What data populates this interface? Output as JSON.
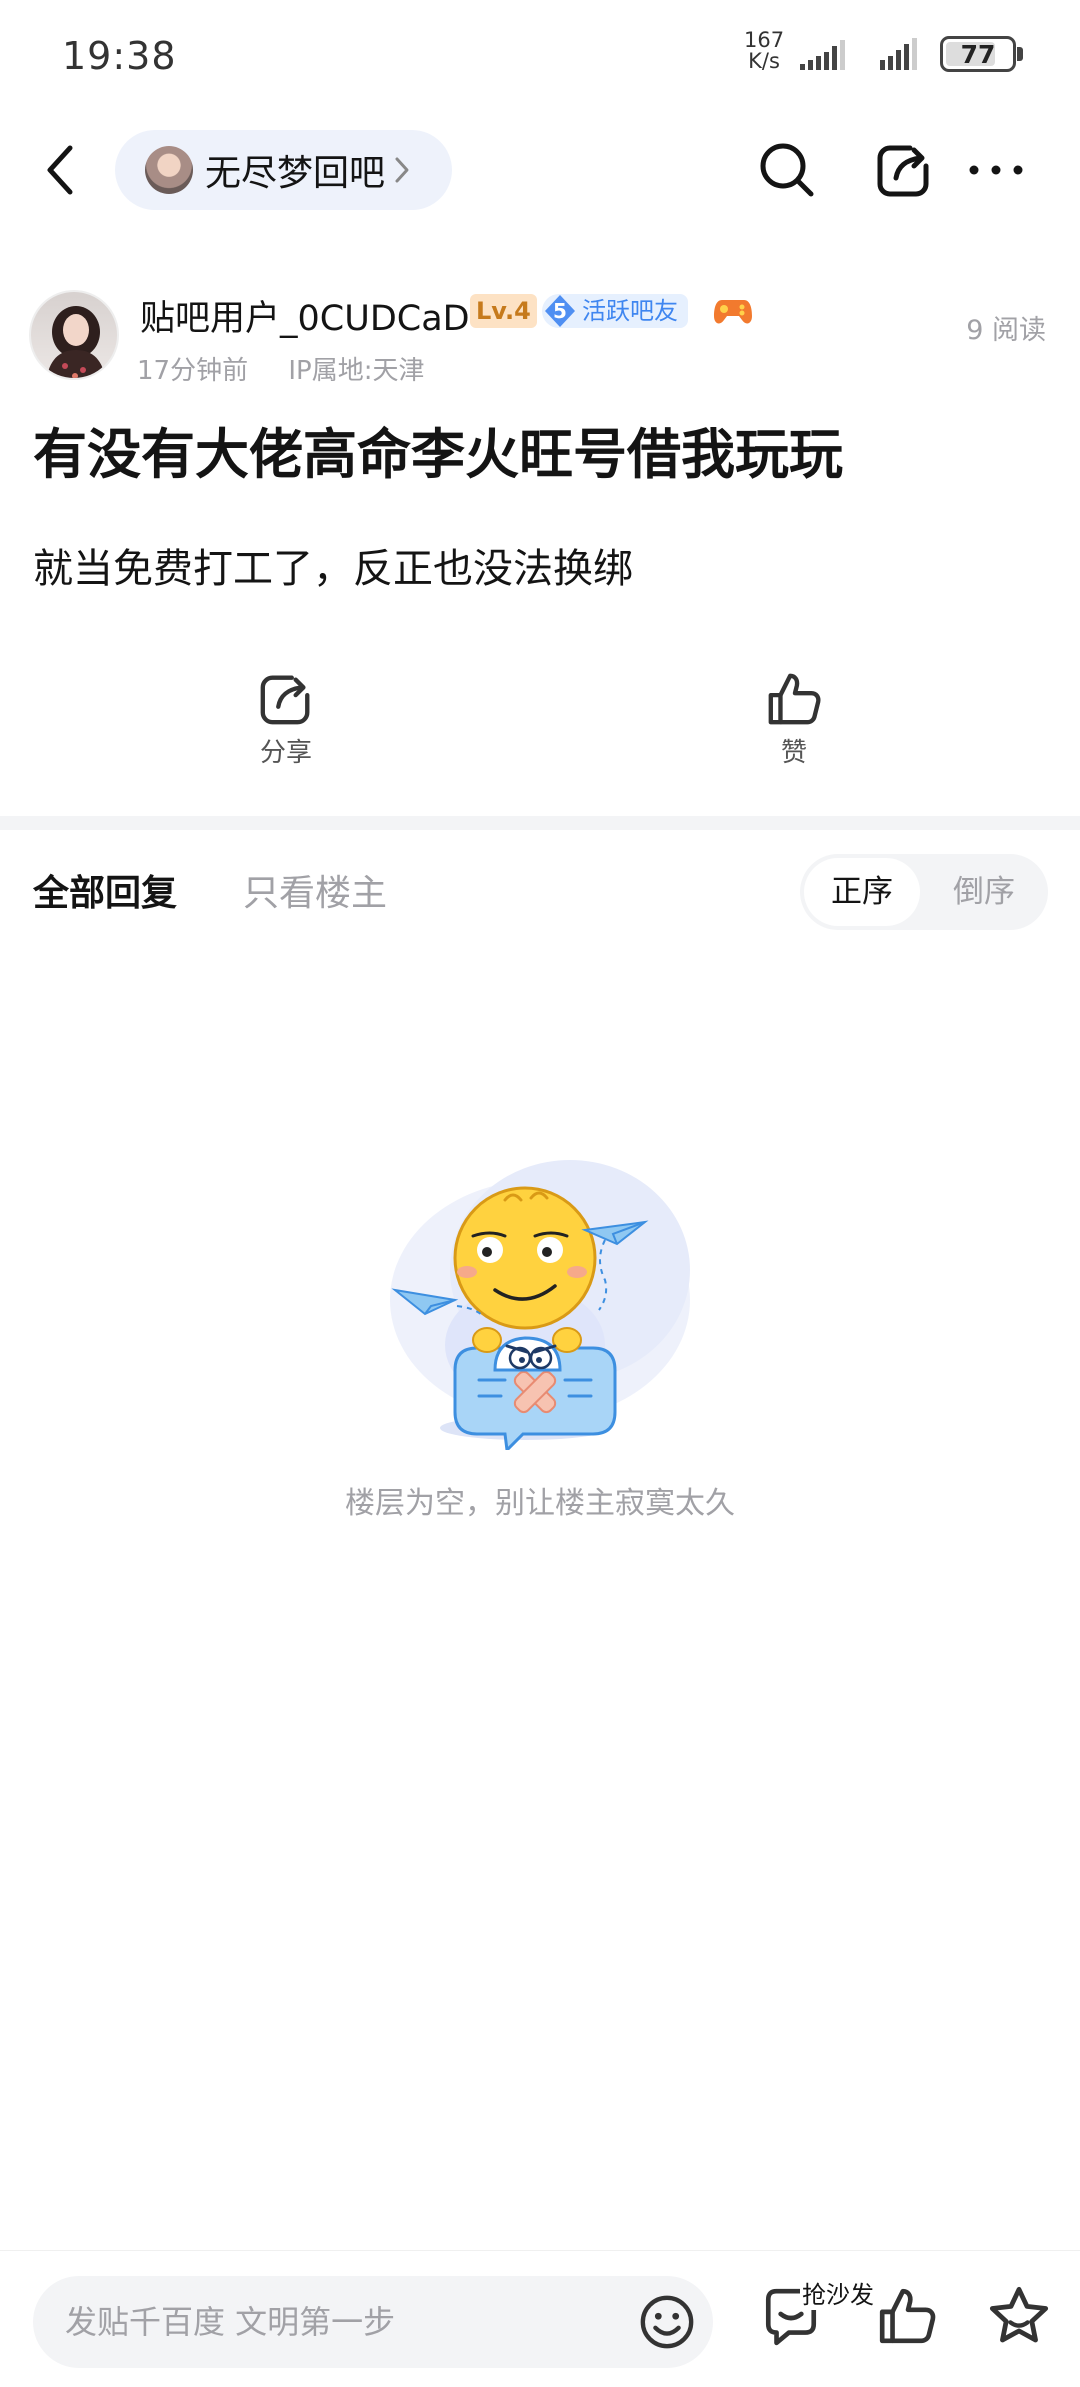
{
  "status_bar": {
    "time": "19:38",
    "net_speed_value": "167",
    "net_speed_unit": "K/s",
    "battery": "77",
    "battery_level": 0.77
  },
  "nav": {
    "forum_name": "无尽梦回吧"
  },
  "post": {
    "author": "贴吧用户_0CUDCaD",
    "level_badge": "Lv.4",
    "active_level": "5",
    "active_badge": "活跃吧友",
    "time_ago": "17分钟前",
    "ip_location": "IP属地:天津",
    "read_count": "9 阅读",
    "title": "有没有大佬高命李火旺号借我玩玩",
    "content": "就当免费打工了，反正也没法换绑"
  },
  "actions": {
    "share": "分享",
    "like": "赞"
  },
  "replies": {
    "tab_all": "全部回复",
    "tab_op_only": "只看楼主",
    "sort_asc": "正序",
    "sort_desc": "倒序",
    "empty_text": "楼层为空，别让楼主寂寞太久"
  },
  "bottom_bar": {
    "input_placeholder": "发贴千百度 文明第一步",
    "sofa_label": "抢沙发"
  },
  "colors": {
    "accent_blue": "#3f86f0",
    "level_orange": "#c67a1c",
    "muted_text": "#a1a1a6",
    "pill_bg": "#eef2fb"
  }
}
